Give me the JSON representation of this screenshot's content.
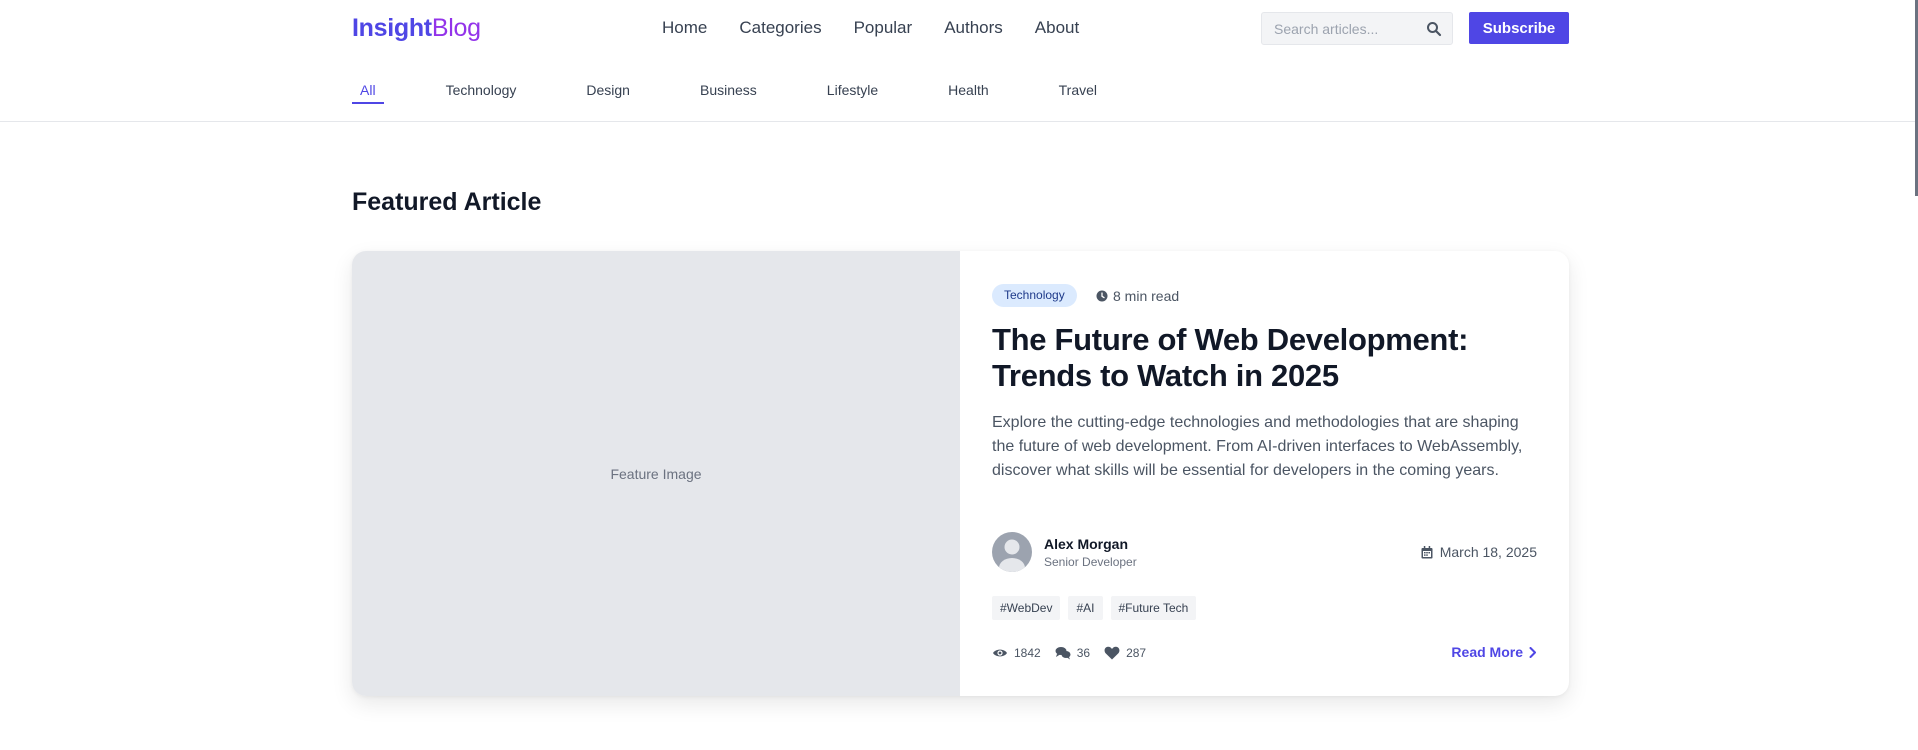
{
  "header": {
    "logo_part1": "Insight",
    "logo_part2": "Blog",
    "nav": [
      "Home",
      "Categories",
      "Popular",
      "Authors",
      "About"
    ],
    "search_placeholder": "Search articles...",
    "subscribe_label": "Subscribe"
  },
  "categories": [
    "All",
    "Technology",
    "Design",
    "Business",
    "Lifestyle",
    "Health",
    "Travel"
  ],
  "featured": {
    "section_title": "Featured Article",
    "image_placeholder": "Feature Image",
    "category": "Technology",
    "read_time": "8 min read",
    "title": "The Future of Web Development: Trends to Watch in 2025",
    "excerpt": "Explore the cutting-edge technologies and methodologies that are shaping the future of web development. From AI-driven interfaces to WebAssembly, discover what skills will be essential for developers in the coming years.",
    "author_name": "Alex Morgan",
    "author_role": "Senior Developer",
    "date": "March 18, 2025",
    "tags": [
      "#WebDev",
      "#AI",
      "#Future Tech"
    ],
    "views": "1842",
    "comments": "36",
    "likes": "287",
    "read_more": "Read More"
  },
  "colors": {
    "accent": "#4f46e5",
    "logo_secondary": "#9333ea",
    "badge_bg": "#dbeafe"
  },
  "icons": {
    "search": "search-icon",
    "clock": "clock-icon",
    "calendar": "calendar-icon",
    "eye": "eye-icon",
    "comments": "comments-icon",
    "heart": "heart-icon",
    "chevron": "chevron-right-icon",
    "avatar": "user-avatar-icon"
  }
}
